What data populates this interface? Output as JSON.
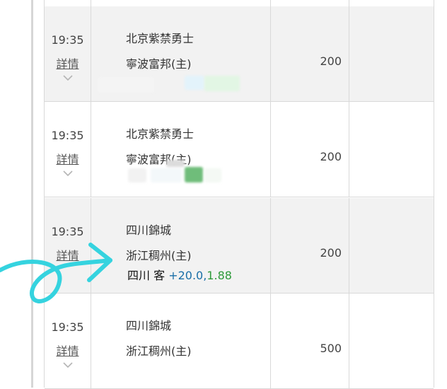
{
  "rows": [
    {
      "time": "19:35",
      "detail_label": "詳情",
      "team_away": "北京紫禁勇士",
      "team_home": "寧波富邦(主)",
      "amount": "200"
    },
    {
      "time": "19:35",
      "detail_label": "詳情",
      "team_away": "北京紫禁勇士",
      "team_home": "寧波富邦(主)",
      "amount": "200"
    },
    {
      "time": "19:35",
      "detail_label": "詳情",
      "team_away": "四川錦城",
      "team_home": "浙江稠州(主)",
      "amount": "200",
      "bet": {
        "side": "四川 客",
        "line": "+20.0,",
        "odds": "1.88"
      }
    },
    {
      "time": "19:35",
      "detail_label": "詳情",
      "team_away": "四川錦城",
      "team_home": "浙江稠州(主)",
      "amount": "500"
    }
  ],
  "colors": {
    "line_value": "#1a6fa8",
    "odds_value": "#2e9a3a",
    "annotation_arrow": "#35d3df",
    "row_shade": "#f2f2f2"
  },
  "icons": {
    "chevron": "chevron-down-icon",
    "annotation": "hand-drawn-arrow-icon"
  }
}
